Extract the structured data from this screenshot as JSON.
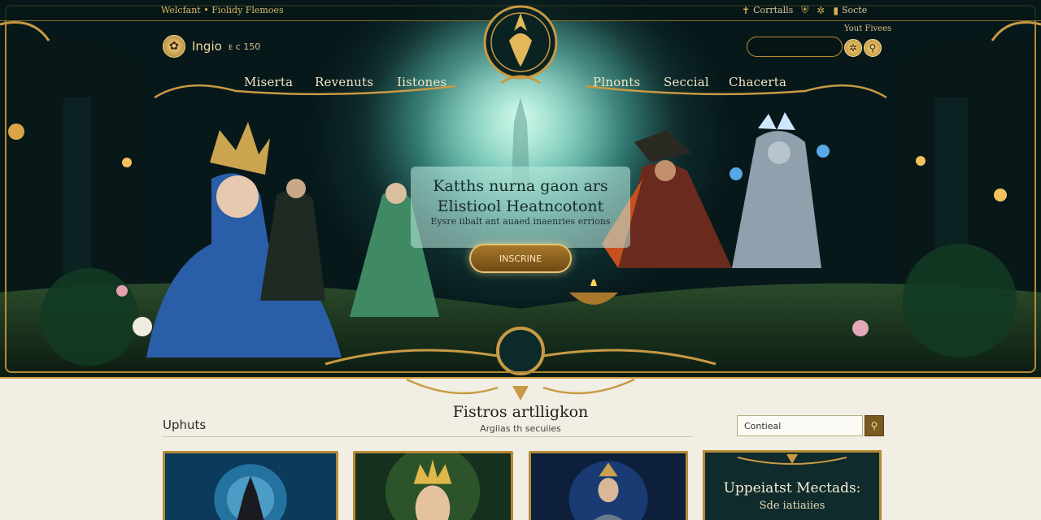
{
  "topbar": {
    "welcome_text": "Welcfant • Fiolidy Flemoes",
    "links": [
      {
        "icon": "pin-icon",
        "label": "Corrtalls"
      },
      {
        "icon": "shield-icon",
        "label": ""
      },
      {
        "icon": "gear-icon",
        "label": ""
      },
      {
        "icon": "book-icon",
        "label": "Socte"
      }
    ]
  },
  "logo": {
    "name": "Ingio",
    "suffix": "ᴇ ᴄ 150"
  },
  "header_search": {
    "placeholder": "",
    "favorites_label": "Yout Fivees"
  },
  "nav": {
    "left": [
      "Miserta",
      "Revenuts",
      "Iistones"
    ],
    "right": [
      "Plnonts",
      "Seccial",
      "Chacerta"
    ]
  },
  "hero": {
    "title_line1": "Katths nurna gaon ars",
    "title_line2": "Elistiool Heatncotont",
    "subtitle": "Eysre iibalt ant auaed inaenries errions",
    "cta_label": "INSCRINE"
  },
  "section": {
    "left_heading": "Uphuts",
    "title": "Fistros artlligkon",
    "subtitle": "Argiias th secuiies"
  },
  "sidebar_search": {
    "value": "Contieal"
  },
  "promo": {
    "title": "Uppeiatst Mectads:",
    "subtitle": "Sde iatiaiies"
  },
  "colors": {
    "gold": "#b68a36",
    "teal_dark": "#0f2b2c",
    "parchment": "#f1eee4"
  }
}
